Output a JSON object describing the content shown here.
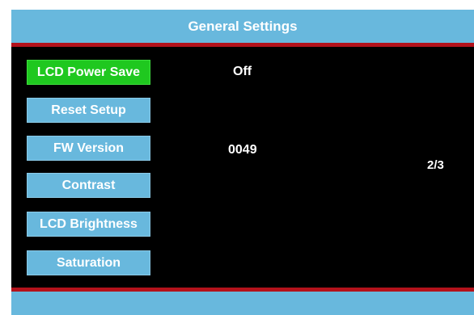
{
  "header": {
    "title": "General Settings"
  },
  "menu": {
    "items": [
      {
        "label": "LCD Power Save",
        "selected": true,
        "value": "Off"
      },
      {
        "label": "Reset Setup",
        "selected": false,
        "value": ""
      },
      {
        "label": "FW Version",
        "selected": false,
        "value": "0049"
      },
      {
        "label": "Contrast",
        "selected": false,
        "value": ""
      },
      {
        "label": "LCD Brightness",
        "selected": false,
        "value": ""
      },
      {
        "label": "Saturation",
        "selected": false,
        "value": ""
      }
    ]
  },
  "pager": {
    "text": "2/3"
  },
  "colors": {
    "header_bg": "#68b8dd",
    "divider": "#b3121b",
    "selected_bg": "#1fc81f",
    "button_bg": "#68b8dd",
    "screen_bg": "#000000",
    "text": "#ffffff"
  }
}
